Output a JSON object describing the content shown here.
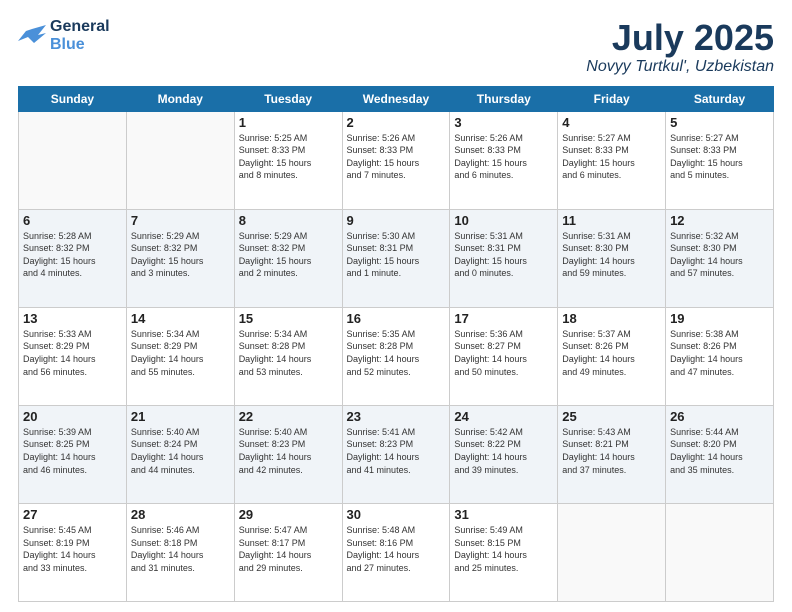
{
  "header": {
    "logo_line1": "General",
    "logo_line2": "Blue",
    "month": "July 2025",
    "location": "Novyy Turtkul', Uzbekistan"
  },
  "days_of_week": [
    "Sunday",
    "Monday",
    "Tuesday",
    "Wednesday",
    "Thursday",
    "Friday",
    "Saturday"
  ],
  "weeks": [
    [
      {
        "day": "",
        "info": ""
      },
      {
        "day": "",
        "info": ""
      },
      {
        "day": "1",
        "info": "Sunrise: 5:25 AM\nSunset: 8:33 PM\nDaylight: 15 hours\nand 8 minutes."
      },
      {
        "day": "2",
        "info": "Sunrise: 5:26 AM\nSunset: 8:33 PM\nDaylight: 15 hours\nand 7 minutes."
      },
      {
        "day": "3",
        "info": "Sunrise: 5:26 AM\nSunset: 8:33 PM\nDaylight: 15 hours\nand 6 minutes."
      },
      {
        "day": "4",
        "info": "Sunrise: 5:27 AM\nSunset: 8:33 PM\nDaylight: 15 hours\nand 6 minutes."
      },
      {
        "day": "5",
        "info": "Sunrise: 5:27 AM\nSunset: 8:33 PM\nDaylight: 15 hours\nand 5 minutes."
      }
    ],
    [
      {
        "day": "6",
        "info": "Sunrise: 5:28 AM\nSunset: 8:32 PM\nDaylight: 15 hours\nand 4 minutes."
      },
      {
        "day": "7",
        "info": "Sunrise: 5:29 AM\nSunset: 8:32 PM\nDaylight: 15 hours\nand 3 minutes."
      },
      {
        "day": "8",
        "info": "Sunrise: 5:29 AM\nSunset: 8:32 PM\nDaylight: 15 hours\nand 2 minutes."
      },
      {
        "day": "9",
        "info": "Sunrise: 5:30 AM\nSunset: 8:31 PM\nDaylight: 15 hours\nand 1 minute."
      },
      {
        "day": "10",
        "info": "Sunrise: 5:31 AM\nSunset: 8:31 PM\nDaylight: 15 hours\nand 0 minutes."
      },
      {
        "day": "11",
        "info": "Sunrise: 5:31 AM\nSunset: 8:30 PM\nDaylight: 14 hours\nand 59 minutes."
      },
      {
        "day": "12",
        "info": "Sunrise: 5:32 AM\nSunset: 8:30 PM\nDaylight: 14 hours\nand 57 minutes."
      }
    ],
    [
      {
        "day": "13",
        "info": "Sunrise: 5:33 AM\nSunset: 8:29 PM\nDaylight: 14 hours\nand 56 minutes."
      },
      {
        "day": "14",
        "info": "Sunrise: 5:34 AM\nSunset: 8:29 PM\nDaylight: 14 hours\nand 55 minutes."
      },
      {
        "day": "15",
        "info": "Sunrise: 5:34 AM\nSunset: 8:28 PM\nDaylight: 14 hours\nand 53 minutes."
      },
      {
        "day": "16",
        "info": "Sunrise: 5:35 AM\nSunset: 8:28 PM\nDaylight: 14 hours\nand 52 minutes."
      },
      {
        "day": "17",
        "info": "Sunrise: 5:36 AM\nSunset: 8:27 PM\nDaylight: 14 hours\nand 50 minutes."
      },
      {
        "day": "18",
        "info": "Sunrise: 5:37 AM\nSunset: 8:26 PM\nDaylight: 14 hours\nand 49 minutes."
      },
      {
        "day": "19",
        "info": "Sunrise: 5:38 AM\nSunset: 8:26 PM\nDaylight: 14 hours\nand 47 minutes."
      }
    ],
    [
      {
        "day": "20",
        "info": "Sunrise: 5:39 AM\nSunset: 8:25 PM\nDaylight: 14 hours\nand 46 minutes."
      },
      {
        "day": "21",
        "info": "Sunrise: 5:40 AM\nSunset: 8:24 PM\nDaylight: 14 hours\nand 44 minutes."
      },
      {
        "day": "22",
        "info": "Sunrise: 5:40 AM\nSunset: 8:23 PM\nDaylight: 14 hours\nand 42 minutes."
      },
      {
        "day": "23",
        "info": "Sunrise: 5:41 AM\nSunset: 8:23 PM\nDaylight: 14 hours\nand 41 minutes."
      },
      {
        "day": "24",
        "info": "Sunrise: 5:42 AM\nSunset: 8:22 PM\nDaylight: 14 hours\nand 39 minutes."
      },
      {
        "day": "25",
        "info": "Sunrise: 5:43 AM\nSunset: 8:21 PM\nDaylight: 14 hours\nand 37 minutes."
      },
      {
        "day": "26",
        "info": "Sunrise: 5:44 AM\nSunset: 8:20 PM\nDaylight: 14 hours\nand 35 minutes."
      }
    ],
    [
      {
        "day": "27",
        "info": "Sunrise: 5:45 AM\nSunset: 8:19 PM\nDaylight: 14 hours\nand 33 minutes."
      },
      {
        "day": "28",
        "info": "Sunrise: 5:46 AM\nSunset: 8:18 PM\nDaylight: 14 hours\nand 31 minutes."
      },
      {
        "day": "29",
        "info": "Sunrise: 5:47 AM\nSunset: 8:17 PM\nDaylight: 14 hours\nand 29 minutes."
      },
      {
        "day": "30",
        "info": "Sunrise: 5:48 AM\nSunset: 8:16 PM\nDaylight: 14 hours\nand 27 minutes."
      },
      {
        "day": "31",
        "info": "Sunrise: 5:49 AM\nSunset: 8:15 PM\nDaylight: 14 hours\nand 25 minutes."
      },
      {
        "day": "",
        "info": ""
      },
      {
        "day": "",
        "info": ""
      }
    ]
  ]
}
